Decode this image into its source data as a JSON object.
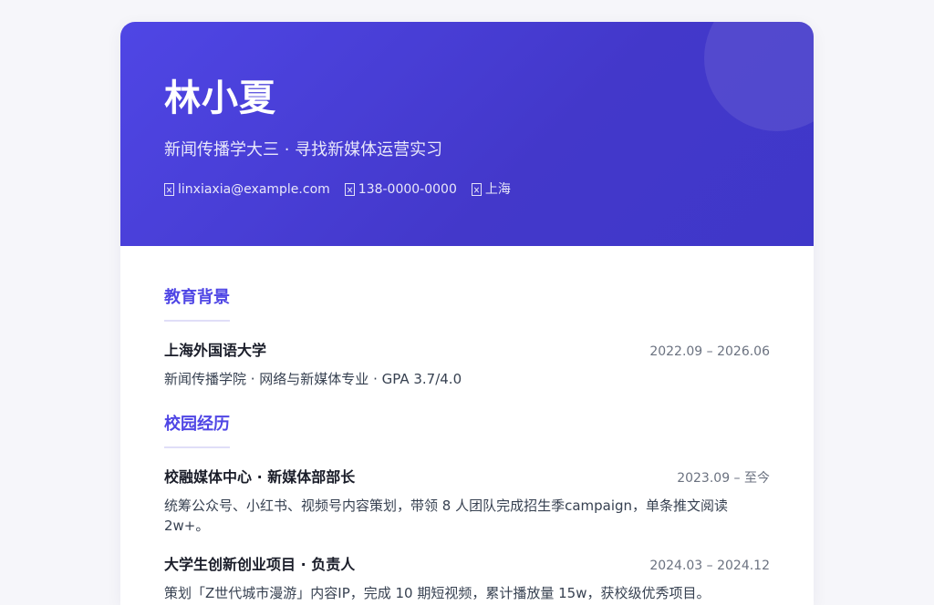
{
  "header": {
    "name": "林小夏",
    "tagline": "新闻传播学大三 · 寻找新媒体运营实习",
    "contacts": [
      {
        "icon": "email-icon",
        "text": "linxiaxia@example.com"
      },
      {
        "icon": "phone-icon",
        "text": "138-0000-0000"
      },
      {
        "icon": "location-icon",
        "text": "上海"
      }
    ]
  },
  "education": {
    "title": "教育背景",
    "entries": [
      {
        "title": "上海外国语大学",
        "date": "2022.09 – 2026.06",
        "desc": "新闻传播学院 · 网络与新媒体专业 · GPA 3.7/4.0"
      }
    ]
  },
  "experience": {
    "title": "校园经历",
    "entries": [
      {
        "title": "校融媒体中心 · 新媒体部部长",
        "date": "2023.09 – 至今",
        "desc": "统筹公众号、小红书、视频号内容策划，带领 8 人团队完成招生季campaign，单条推文阅读 2w+。"
      },
      {
        "title": "大学生创新创业项目 · 负责人",
        "date": "2024.03 – 2024.12",
        "desc": "策划「Z世代城市漫游」内容IP，完成 10 期短视频，累计播放量 15w，获校级优秀项目。"
      }
    ]
  },
  "colors": {
    "accent": "#4f46e5",
    "header_gradient_start": "#4f46e5",
    "header_gradient_end": "#3f37c9"
  }
}
